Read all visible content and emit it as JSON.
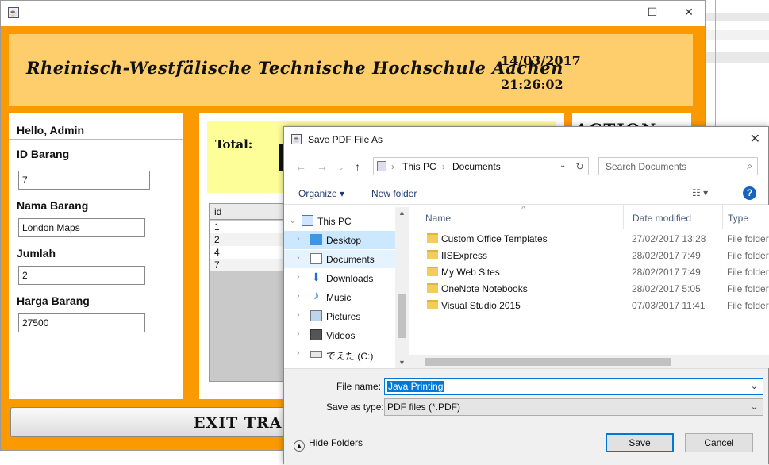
{
  "main_window": {
    "header": {
      "university": "Rheinisch-Westfälische Technische Hochschule Aachen",
      "date": "14/03/2017",
      "time": "21:26:02"
    },
    "form": {
      "greeting": "Hello, Admin",
      "id_label": "ID Barang",
      "id_value": "7",
      "nama_label": "Nama Barang",
      "nama_value": "London Maps",
      "jumlah_label": "Jumlah",
      "jumlah_value": "2",
      "harga_label": "Harga Barang",
      "harga_value": "27500"
    },
    "total_label": "Total:",
    "table": {
      "header": "id",
      "rows": [
        "1",
        "2",
        "4",
        "7"
      ]
    },
    "action_label": "ACTION",
    "exit_label": "EXIT TRA"
  },
  "dialog": {
    "title": "Save PDF File As",
    "breadcrumb": [
      "This PC",
      "Documents"
    ],
    "search_placeholder": "Search Documents",
    "organize_label": "Organize ▾",
    "new_folder_label": "New folder",
    "help_glyph": "?",
    "nav_items": [
      {
        "label": "This PC",
        "icon": "computer-icon"
      },
      {
        "label": "Desktop",
        "icon": "desktop-folder-icon"
      },
      {
        "label": "Documents",
        "icon": "documents-icon"
      },
      {
        "label": "Downloads",
        "icon": "download-arrow-icon"
      },
      {
        "label": "Music",
        "icon": "music-note-icon"
      },
      {
        "label": "Pictures",
        "icon": "pictures-icon"
      },
      {
        "label": "Videos",
        "icon": "videos-icon"
      },
      {
        "label": "でえた (C:)",
        "icon": "drive-icon"
      }
    ],
    "columns": {
      "name": "Name",
      "date": "Date modified",
      "type": "Type"
    },
    "files": [
      {
        "name": "Custom Office Templates",
        "date": "27/02/2017 13:28",
        "type": "File folder"
      },
      {
        "name": "IISExpress",
        "date": "28/02/2017 7:49",
        "type": "File folder"
      },
      {
        "name": "My Web Sites",
        "date": "28/02/2017 7:49",
        "type": "File folder"
      },
      {
        "name": "OneNote Notebooks",
        "date": "28/02/2017 5:05",
        "type": "File folder"
      },
      {
        "name": "Visual Studio 2015",
        "date": "07/03/2017 11:41",
        "type": "File folder"
      }
    ],
    "file_name_label": "File name:",
    "file_name_value": "Java Printing",
    "save_type_label": "Save as type:",
    "save_type_value": "PDF files (*.PDF)",
    "hide_folders_label": "Hide Folders",
    "save_label": "Save",
    "cancel_label": "Cancel"
  },
  "colors": {
    "frame_orange": "#fb9a00",
    "header_yellow": "#fecd6c",
    "total_yellow": "#fefe99",
    "accent_blue": "#0078d7"
  }
}
